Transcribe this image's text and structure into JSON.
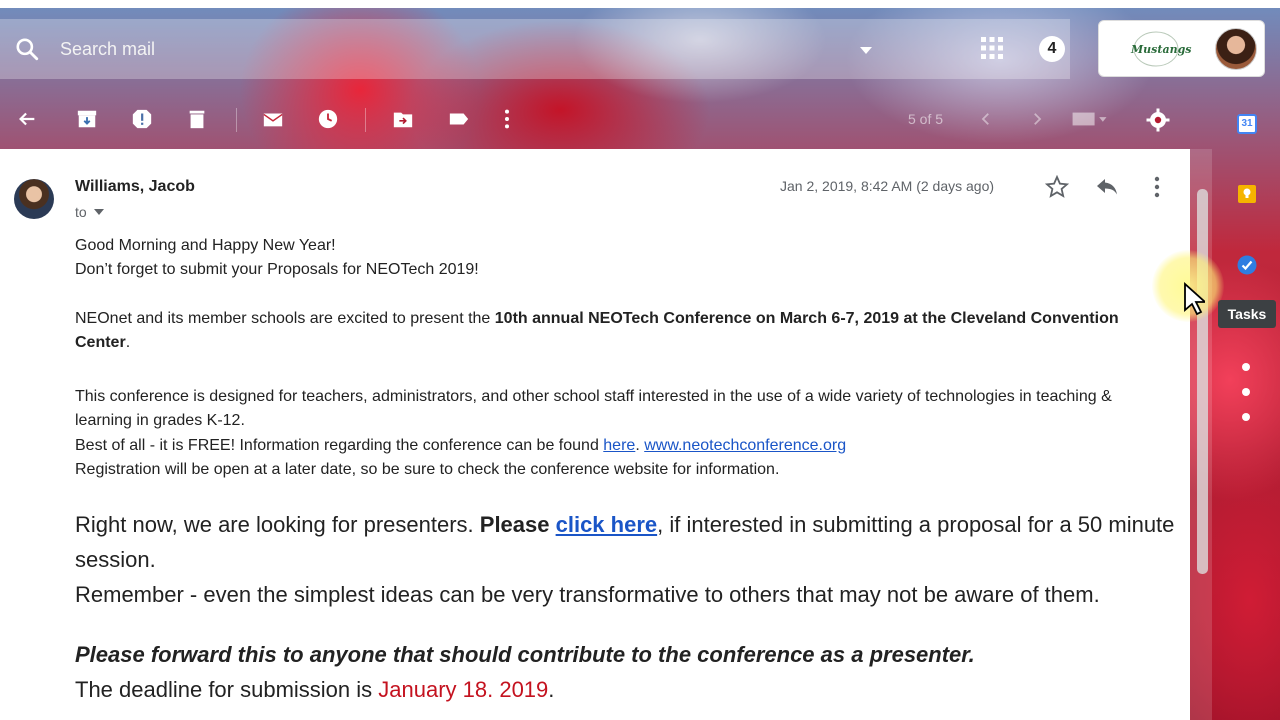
{
  "header": {
    "search_placeholder": "Search mail",
    "notification_count": "4",
    "org_logo_text": "Mustangs"
  },
  "toolbar": {
    "page_count": "5 of 5",
    "icons": [
      "back-arrow-icon",
      "archive-icon",
      "report-spam-icon",
      "delete-icon",
      "mark-unread-icon",
      "snooze-icon",
      "move-to-icon",
      "label-icon",
      "more-vert-icon",
      "chevron-left-icon",
      "chevron-right-icon",
      "keyboard-icon",
      "settings-icon"
    ]
  },
  "message": {
    "sender": "Williams, Jacob",
    "recipient_prefix": "to",
    "date": "Jan 2, 2019, 8:42 AM (2 days ago)",
    "greeting": "Good Morning and Happy New Year!",
    "reminder": "Don’t forget to submit your Proposals for NEOTech 2019!",
    "p1_pre": "NEOnet and its member schools are excited to present the ",
    "p1_bold": "10th annual NEOTech Conference on March 6-7, 2019 at the Cleveland Convention Center",
    "p1_post": ".",
    "p2": "This conference is designed for teachers, administrators, and other school staff interested in the use of a wide variety of technologies in teaching & learning in grades K-12.",
    "p3_pre": "Best of all - it is FREE! Information regarding the conference can be found ",
    "p3_link1": "here",
    "p3_mid": ". ",
    "p3_link2": "www.neotechconference.org",
    "p4": "Registration will be open at a later date, so be sure to check the conference website for information.",
    "big1_pre": "Right now, we are looking for presenters. ",
    "big1_bold": "Please ",
    "big1_link": "click here",
    "big1_post": ", if interested in submitting a proposal for a 50 minute session.",
    "big2": "Remember - even the simplest ideas can be very transformative to others that may not be aware of them.",
    "big3": "Please forward this to anyone that should contribute to the conference as a presenter.",
    "big4_pre": "The deadline for submission is ",
    "big4_date": "January 18. 2019",
    "big4_post": "."
  },
  "side_panel": {
    "calendar_day": "31",
    "tasks_tooltip": "Tasks"
  },
  "colors": {
    "link": "#1a55c7",
    "deadline_red": "#c4121f",
    "tooltip_bg": "#3c4043"
  }
}
